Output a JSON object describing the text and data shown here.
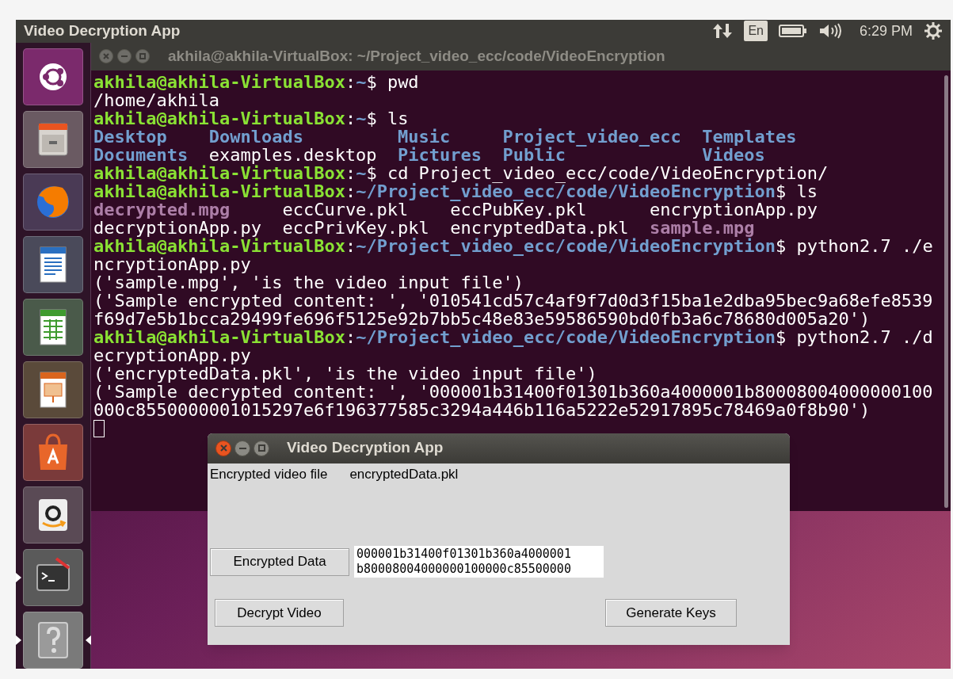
{
  "top_bar": {
    "title": "Video Decryption App",
    "input_language": "En",
    "clock": "6:29 PM"
  },
  "launcher": {
    "items": [
      {
        "kind": "dash",
        "running": false,
        "focused": false
      },
      {
        "kind": "files",
        "running": false,
        "focused": false
      },
      {
        "kind": "browser",
        "running": false,
        "focused": false
      },
      {
        "kind": "writer",
        "running": false,
        "focused": false
      },
      {
        "kind": "calc",
        "running": false,
        "focused": false
      },
      {
        "kind": "impress",
        "running": false,
        "focused": false
      },
      {
        "kind": "store",
        "running": false,
        "focused": false
      },
      {
        "kind": "amazon",
        "running": false,
        "focused": false
      },
      {
        "kind": "terminal",
        "running": true,
        "focused": false
      },
      {
        "kind": "help",
        "running": true,
        "focused": true
      }
    ]
  },
  "terminal": {
    "title": "akhila@akhila-VirtualBox: ~/Project_video_ecc/code/VideoEncryption",
    "cursor": true,
    "lines": [
      {
        "kind": "line",
        "segments": [
          {
            "text": "akhila@akhila-VirtualBox",
            "kind": "user"
          },
          {
            "text": ":",
            "kind": "plain"
          },
          {
            "text": "~",
            "kind": "path"
          },
          {
            "text": "$ pwd",
            "kind": "plain"
          }
        ]
      },
      {
        "kind": "line",
        "segments": [
          {
            "text": "/home/akhila",
            "kind": "plain"
          }
        ]
      },
      {
        "kind": "line",
        "segments": [
          {
            "text": "akhila@akhila-VirtualBox",
            "kind": "user"
          },
          {
            "text": ":",
            "kind": "plain"
          },
          {
            "text": "~",
            "kind": "path"
          },
          {
            "text": "$ ls",
            "kind": "plain"
          }
        ]
      },
      {
        "kind": "listing",
        "rows": [
          [
            {
              "text": "Desktop",
              "kind": "dir"
            },
            {
              "text": "Downloads",
              "kind": "dir"
            },
            {
              "text": "Music",
              "kind": "dir"
            },
            {
              "text": "Project_video_ecc",
              "kind": "dir"
            },
            {
              "text": "Templates",
              "kind": "dir"
            }
          ],
          [
            {
              "text": "Documents",
              "kind": "dir"
            },
            {
              "text": "examples.desktop",
              "kind": "plain"
            },
            {
              "text": "Pictures",
              "kind": "dir"
            },
            {
              "text": "Public",
              "kind": "dir"
            },
            {
              "text": "Videos",
              "kind": "dir"
            }
          ]
        ]
      },
      {
        "kind": "line",
        "segments": [
          {
            "text": "akhila@akhila-VirtualBox",
            "kind": "user"
          },
          {
            "text": ":",
            "kind": "plain"
          },
          {
            "text": "~",
            "kind": "path"
          },
          {
            "text": "$ cd Project_video_ecc/code/VideoEncryption/",
            "kind": "plain"
          }
        ]
      },
      {
        "kind": "line",
        "segments": [
          {
            "text": "akhila@akhila-VirtualBox",
            "kind": "user"
          },
          {
            "text": ":",
            "kind": "plain"
          },
          {
            "text": "~/Project_video_ecc/code/VideoEncryption",
            "kind": "path"
          },
          {
            "text": "$ ls",
            "kind": "plain"
          }
        ]
      },
      {
        "kind": "listing",
        "rows": [
          [
            {
              "text": "decrypted.mpg",
              "kind": "media"
            },
            {
              "text": "eccCurve.pkl",
              "kind": "plain"
            },
            {
              "text": "eccPubKey.pkl",
              "kind": "plain"
            },
            {
              "text": "encryptionApp.py",
              "kind": "plain"
            }
          ],
          [
            {
              "text": "decryptionApp.py",
              "kind": "plain"
            },
            {
              "text": "eccPrivKey.pkl",
              "kind": "plain"
            },
            {
              "text": "encryptedData.pkl",
              "kind": "plain"
            },
            {
              "text": "sample.mpg",
              "kind": "media"
            }
          ]
        ]
      },
      {
        "kind": "line",
        "segments": [
          {
            "text": "akhila@akhila-VirtualBox",
            "kind": "user"
          },
          {
            "text": ":",
            "kind": "plain"
          },
          {
            "text": "~/Project_video_ecc/code/VideoEncryption",
            "kind": "path"
          },
          {
            "text": "$ python2.7 ./e",
            "kind": "plain"
          }
        ]
      },
      {
        "kind": "line",
        "segments": [
          {
            "text": "ncryptionApp.py",
            "kind": "plain"
          }
        ]
      },
      {
        "kind": "line",
        "segments": [
          {
            "text": "('sample.mpg', 'is the video input file')",
            "kind": "plain"
          }
        ]
      },
      {
        "kind": "line",
        "segments": [
          {
            "text": "('Sample encrypted content: ', '010541cd57c4af9f7d0d3f15ba1e2dba95bec9a68efe8539",
            "kind": "plain"
          }
        ]
      },
      {
        "kind": "line",
        "segments": [
          {
            "text": "f69d7e5b1bcca29499fe696f5125e92b7bb5c48e83e59586590bd0fb3a6c78680d005a20')",
            "kind": "plain"
          }
        ]
      },
      {
        "kind": "line",
        "segments": [
          {
            "text": "akhila@akhila-VirtualBox",
            "kind": "user"
          },
          {
            "text": ":",
            "kind": "plain"
          },
          {
            "text": "~/Project_video_ecc/code/VideoEncryption",
            "kind": "path"
          },
          {
            "text": "$ python2.7 ./d",
            "kind": "plain"
          }
        ]
      },
      {
        "kind": "line",
        "segments": [
          {
            "text": "ecryptionApp.py",
            "kind": "plain"
          }
        ]
      },
      {
        "kind": "line",
        "segments": [
          {
            "text": "('encryptedData.pkl', 'is the video input file')",
            "kind": "plain"
          }
        ]
      },
      {
        "kind": "line",
        "segments": [
          {
            "text": "('Sample decrypted content: ', '000001b31400f01301b360a4000001b80008004000000100",
            "kind": "plain"
          }
        ]
      },
      {
        "kind": "line",
        "segments": [
          {
            "text": "000c8550000001015297e6f196377585c3294a446b116a5222e52917895c78469a0f8b90')",
            "kind": "plain"
          }
        ]
      }
    ]
  },
  "dialog": {
    "title": "Video Decryption App",
    "file_label": "Encrypted video file",
    "file_value": "encryptedData.pkl",
    "data_button": "Encrypted Data",
    "data_lines": [
      "000001b31400f01301b360a4000001",
      "b80008004000000100000c85500000"
    ],
    "decrypt_button": "Decrypt Video",
    "keys_button": "Generate Keys"
  }
}
